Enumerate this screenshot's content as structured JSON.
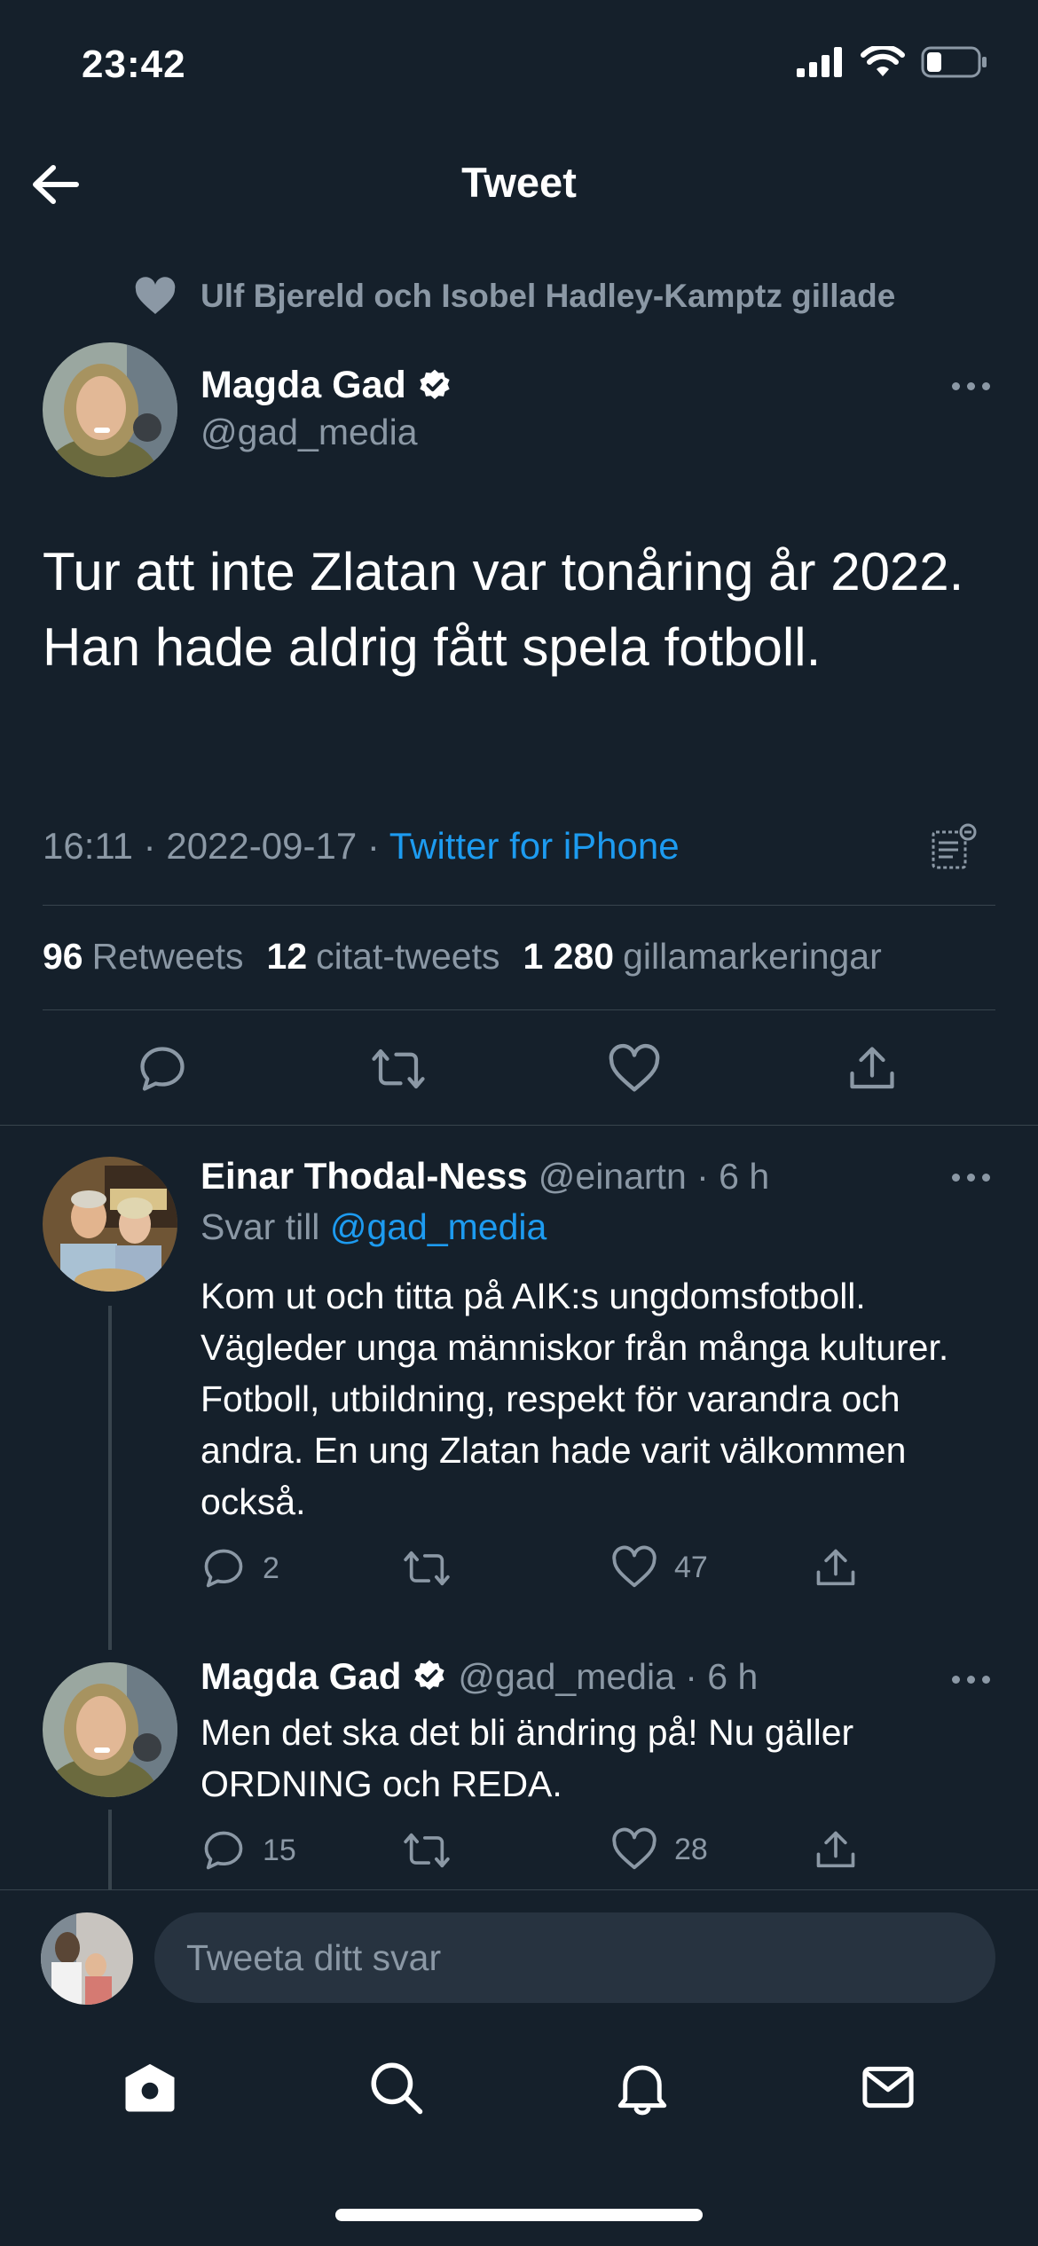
{
  "status_bar": {
    "time": "23:42"
  },
  "header": {
    "title": "Tweet"
  },
  "social_context": {
    "text": "Ulf Bjereld och Isobel Hadley-Kamptz gillade"
  },
  "tweet": {
    "author_name": "Magda Gad",
    "author_handle": "@gad_media",
    "text": "Tur att inte Zlatan var tonåring år 2022. Han hade aldrig fått spela fotboll.",
    "time": "16:11",
    "date": "2022-09-17",
    "source": "Twitter for iPhone",
    "separator": "·",
    "retweets_count": "96",
    "retweets_label": "Retweets",
    "quotes_count": "12",
    "quotes_label": "citat-tweets",
    "likes_count": "1 280",
    "likes_label": "gillamarkeringar"
  },
  "replies": [
    {
      "author_name": "Einar Thodal-Ness",
      "meta": "@einartn · 6 h",
      "reply_to_label": "Svar till",
      "reply_to_handle": "@gad_media",
      "text": "Kom ut och titta på AIK:s ungdomsfotboll. Vägleder unga människor från många kulturer. Fotboll, utbildning, respekt för varandra och andra.   En ung Zlatan hade varit välkommen också.",
      "reply_count": "2",
      "retweet_count": "",
      "like_count": "47"
    },
    {
      "author_name": "Magda Gad",
      "meta": "@gad_media · 6 h",
      "text": "Men det ska det bli ändring på! Nu gäller ORDNING och REDA.",
      "reply_count": "15",
      "retweet_count": "",
      "like_count": "28"
    }
  ],
  "composer": {
    "placeholder": "Tweeta ditt svar"
  },
  "colors": {
    "background": "#15202b",
    "accent": "#1d9bf0",
    "muted": "#8b98a5",
    "divider": "#38444d"
  }
}
